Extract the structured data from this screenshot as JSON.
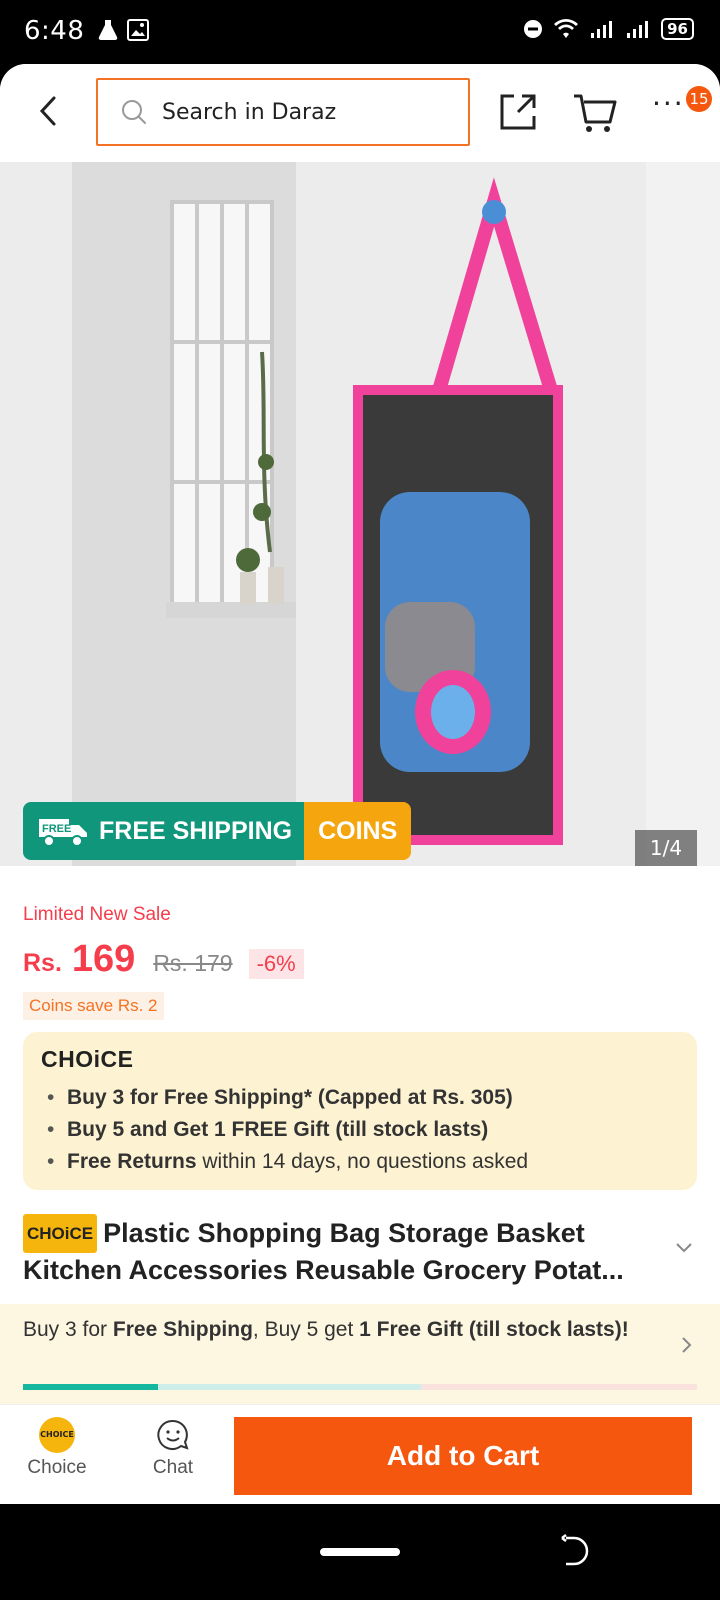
{
  "status_bar": {
    "time": "6:48",
    "battery": "96",
    "icons": [
      "flask-icon",
      "image-icon",
      "dnd-icon",
      "wifi-icon",
      "signal-icon",
      "signal-icon"
    ]
  },
  "header": {
    "search_placeholder": "Search in Daraz",
    "badge_count": "15",
    "icons": [
      "back-arrow-icon",
      "search-icon",
      "share-icon",
      "cart-icon",
      "more-icon"
    ]
  },
  "product_image": {
    "promo_free_shipping": "FREE SHIPPING",
    "promo_free_tag": "FREE",
    "promo_coins": "COINS",
    "page_counter": "1/4"
  },
  "price": {
    "sale_label": "Limited New Sale",
    "currency": "Rs.",
    "value": "169",
    "old_price": "Rs. 179",
    "discount": "-6%",
    "coins_save": "Coins save Rs. 2"
  },
  "choice_box": {
    "logo": "CHOiCE",
    "items": [
      {
        "bold": "Buy 3 for  Free Shipping* (Capped at Rs. 305)",
        "normal": ""
      },
      {
        "bold": "Buy 5 and Get 1 FREE Gift (till stock lasts)",
        "normal": ""
      },
      {
        "bold": "Free Returns",
        "normal": " within 14 days, no questions asked"
      }
    ]
  },
  "product": {
    "choice_tag": "CHOiCE",
    "title": "Plastic Shopping Bag Storage Basket Kitchen Accessories Reusable Grocery Potat..."
  },
  "offer_bar": {
    "text_1": "Buy 3 for ",
    "text_2": "Free Shipping",
    "text_3": ", Buy 5 get ",
    "text_4": "1 Free Gift (till stock lasts)!",
    "progress": 0.2,
    "progress_mid": 0.59
  },
  "bottom_bar": {
    "choice_icon_text": "CHOICE",
    "choice_label": "Choice",
    "chat_label": "Chat",
    "add_to_cart": "Add to Cart"
  },
  "colors": {
    "brand_orange": "#f5570f",
    "price_red": "#f53d4c",
    "choice_yellow": "#f5b50d",
    "shipping_green": "#10967a"
  }
}
